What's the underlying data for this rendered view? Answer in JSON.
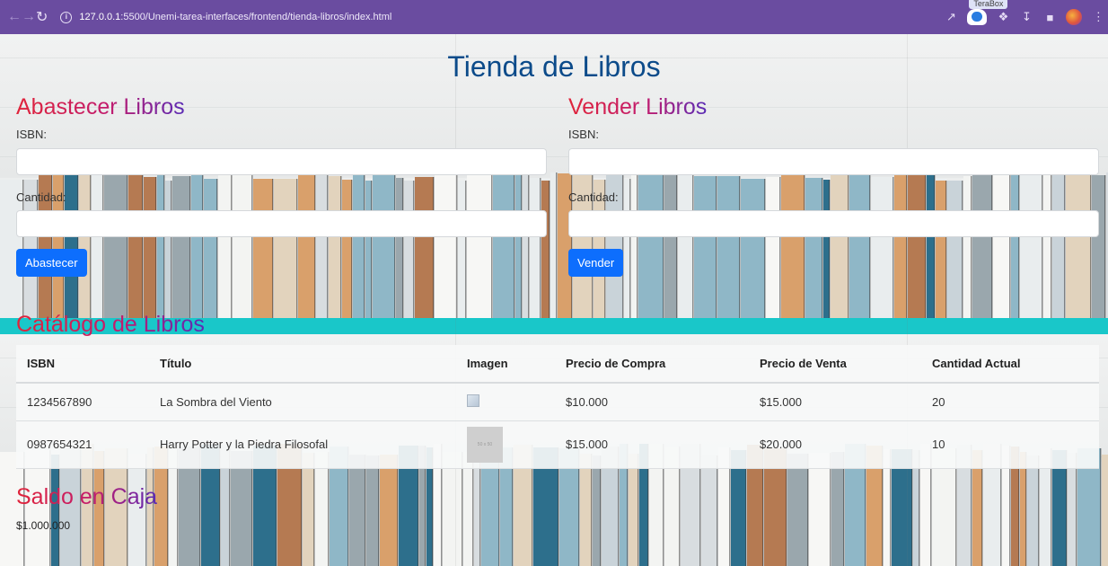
{
  "browser": {
    "url_host": "127.0.0.1",
    "url_path": ":5500/Unemi-tarea-interfaces/frontend/tienda-libros/index.html",
    "extension_tooltip": "TeraBox"
  },
  "page": {
    "title": "Tienda de Libros"
  },
  "abastecer": {
    "title": "Abastecer Libros",
    "isbn_label": "ISBN:",
    "isbn_value": "",
    "cantidad_label": "Cantidad:",
    "cantidad_value": "",
    "button_label": "Abastecer"
  },
  "vender": {
    "title": "Vender Libros",
    "isbn_label": "ISBN:",
    "isbn_value": "",
    "cantidad_label": "Cantidad:",
    "cantidad_value": "",
    "button_label": "Vender"
  },
  "catalogo": {
    "title": "Catálogo de Libros",
    "headers": [
      "ISBN",
      "Título",
      "Imagen",
      "Precio de Compra",
      "Precio de Venta",
      "Cantidad Actual"
    ],
    "rows": [
      {
        "isbn": "1234567890",
        "titulo": "La Sombra del Viento",
        "imagen": "broken",
        "precio_compra": "$10.000",
        "precio_venta": "$15.000",
        "cantidad": "20"
      },
      {
        "isbn": "0987654321",
        "titulo": "Harry Potter y la Piedra Filosofal",
        "imagen": "50 x 50",
        "precio_compra": "$15.000",
        "precio_venta": "$20.000",
        "cantidad": "10"
      }
    ]
  },
  "saldo": {
    "title": "Saldo en Caja",
    "value": "$1.000.000"
  },
  "colors": {
    "chrome": "#6a4ca0",
    "primary_button": "#0d6efd",
    "title_blue": "#0c4b8a",
    "heading_gradient_start": "#e0243a",
    "heading_gradient_end": "#5a2bb5"
  }
}
